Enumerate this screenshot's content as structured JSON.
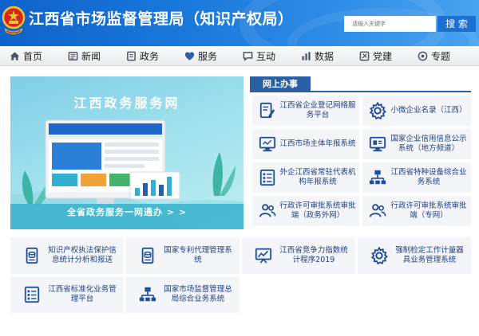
{
  "header": {
    "site_title": "江西省市场监督管理局（知识产权局）",
    "search_placeholder": "请输入关键字",
    "search_button": "搜 索",
    "colors": {
      "header_blue": "#1a79dc",
      "search_button": "#1c6fd3"
    }
  },
  "nav": {
    "items": [
      {
        "label": "首页",
        "icon": "home-icon"
      },
      {
        "label": "新闻",
        "icon": "news-icon"
      },
      {
        "label": "政务",
        "icon": "government-affairs-icon"
      },
      {
        "label": "服务",
        "icon": "service-icon"
      },
      {
        "label": "互动",
        "icon": "interaction-icon"
      },
      {
        "label": "数据",
        "icon": "data-chart-icon"
      },
      {
        "label": "党建",
        "icon": "party-building-icon"
      },
      {
        "label": "专题",
        "icon": "topic-icon"
      }
    ]
  },
  "banner": {
    "title": "江西政务服务网",
    "slogan": "全省政务服务一网通办 > >"
  },
  "online": {
    "title": "网上办事",
    "items": [
      {
        "label": "江西省企业登记网络服务平台",
        "icon": "document-edit-icon"
      },
      {
        "label": "小微企业名录（江西）",
        "icon": "gear-icon"
      },
      {
        "label": "江西市场主体年报系统",
        "icon": "monitor-icon"
      },
      {
        "label": "国家企业信用信息公示系统（地方频道）",
        "icon": "monitor-icon"
      },
      {
        "label": "外企江西省常驻代表机构年报系统",
        "icon": "checklist-icon"
      },
      {
        "label": "江西省特种设备综合业务系统",
        "icon": "network-icon"
      },
      {
        "label": "行政许可审批系统审批端（政务外网）",
        "icon": "users-icon"
      },
      {
        "label": "行政许可审批系统审批端（专网）",
        "icon": "users-icon"
      }
    ]
  },
  "bottom": {
    "items": [
      {
        "label": "知识产权执法保护信息统计分析和报送",
        "icon": "database-icon"
      },
      {
        "label": "国家专利代理管理系统",
        "icon": "database-icon"
      },
      {
        "label": "江西省竞争力指数统计程序2019",
        "icon": "chart-board-icon"
      },
      {
        "label": "强制检定工作计量器具业务管理系统",
        "icon": "gear-icon"
      },
      {
        "label": "江西省标准化业务管理平台",
        "icon": "checklist-icon"
      },
      {
        "label": "国家市场监督管理总局综合业务系统",
        "icon": "network-icon"
      }
    ]
  }
}
